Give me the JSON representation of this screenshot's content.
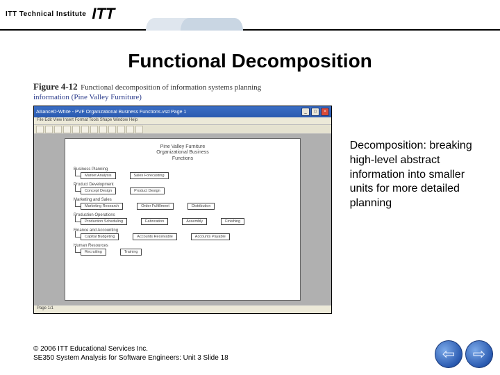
{
  "header": {
    "institute": "ITT Technical Institute",
    "logo": "ITT"
  },
  "title": "Functional Decomposition",
  "figure": {
    "label": "Figure 4-12",
    "title": "Functional decomposition of information systems planning",
    "subtitle": "information (Pine Valley Furniture)"
  },
  "app": {
    "titlebar": "AllianceD-White - PVF Organizational Business Functions.vsd Page 1",
    "menubar": "File  Edit  View  Insert  Format  Tools  Shape  Window  Help",
    "close": "×",
    "status": "Page 1/1"
  },
  "diagram": {
    "head1": "Pine Valley Furniture",
    "head2": "Organizational Business",
    "head3": "Functions",
    "categories": [
      {
        "name": "Business Planning",
        "items": [
          "Market Analysis",
          "Sales Forecasting"
        ]
      },
      {
        "name": "Product Development",
        "items": [
          "Concept Design",
          "Product Design"
        ]
      },
      {
        "name": "Marketing and Sales",
        "items": [
          "Marketing Research",
          "Order Fulfillment",
          "Distribution"
        ]
      },
      {
        "name": "Production Operations",
        "items": [
          "Production Scheduling",
          "Fabrication",
          "Assembly",
          "Finishing"
        ]
      },
      {
        "name": "Finance and Accounting",
        "items": [
          "Capital Budgeting",
          "Accounts Receivable",
          "Accounts Payable"
        ]
      },
      {
        "name": "Human Resources",
        "items": [
          "Recruiting",
          "Training"
        ]
      }
    ]
  },
  "sidetext": "Decomposition: breaking high-level abstract information into smaller units for more detailed planning",
  "footer": {
    "line1": "© 2006 ITT Educational Services Inc.",
    "line2": "SE350 System Analysis for Software Engineers: Unit 3 Slide 18"
  },
  "nav": {
    "prev": "⇦",
    "next": "⇨"
  }
}
